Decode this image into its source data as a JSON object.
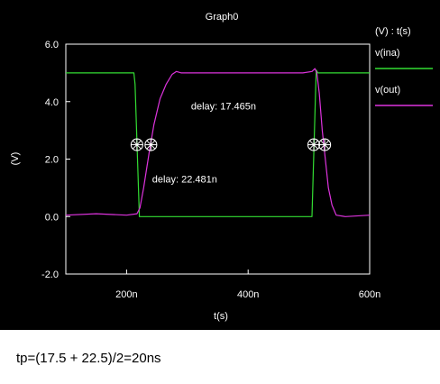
{
  "chart_data": {
    "type": "line",
    "title": "Graph0",
    "xlabel": "t(s)",
    "ylabel": "(V)",
    "xlim": [
      100,
      600
    ],
    "ylim": [
      -2.0,
      6.0
    ],
    "x_ticks": [
      {
        "value": 200,
        "label": "200n"
      },
      {
        "value": 400,
        "label": "400n"
      },
      {
        "value": 600,
        "label": "600n"
      }
    ],
    "y_ticks": [
      {
        "value": -2.0,
        "label": "-2.0"
      },
      {
        "value": 0.0,
        "label": "0.0"
      },
      {
        "value": 2.0,
        "label": "2.0"
      },
      {
        "value": 4.0,
        "label": "4.0"
      },
      {
        "value": 6.0,
        "label": "6.0"
      }
    ],
    "legend_header": "(V) : t(s)",
    "legend_position": "right",
    "series": [
      {
        "name": "v(ina)",
        "color": "#33dd33",
        "x": [
          100,
          212,
          214,
          221,
          505,
          512,
          515,
          600
        ],
        "y": [
          5.0,
          5.0,
          4.6,
          0.0,
          0.0,
          5.1,
          5.0,
          5.0
        ]
      },
      {
        "name": "v(out)",
        "color": "#dd33dd",
        "x": [
          100,
          150,
          200,
          217,
          222,
          228,
          237,
          245,
          255,
          265,
          275,
          282,
          290,
          340,
          400,
          450,
          490,
          505,
          510,
          513,
          517,
          522,
          528,
          532,
          538,
          545,
          560,
          600
        ],
        "y": [
          0.05,
          0.1,
          0.05,
          0.1,
          0.3,
          1.0,
          2.2,
          3.2,
          4.1,
          4.6,
          4.95,
          5.05,
          5.0,
          5.0,
          5.0,
          5.0,
          5.0,
          5.05,
          5.15,
          5.0,
          4.3,
          3.0,
          1.8,
          1.0,
          0.4,
          0.05,
          0.0,
          0.05
        ]
      }
    ],
    "annotations": [
      {
        "text": "delay: 17.465n",
        "x": 306,
        "y": 3.72
      },
      {
        "text": "delay: 22.481n",
        "x": 242,
        "y": 1.18
      }
    ],
    "markers": [
      {
        "name": "ina-fall-cursor",
        "x": 217,
        "y": 2.5
      },
      {
        "name": "out-rise-cursor",
        "x": 240,
        "y": 2.5
      },
      {
        "name": "ina-rise-cursor",
        "x": 508,
        "y": 2.5
      },
      {
        "name": "out-fall-cursor",
        "x": 526,
        "y": 2.5
      }
    ]
  },
  "caption": "tp=(17.5 + 22.5)/2=20ns"
}
